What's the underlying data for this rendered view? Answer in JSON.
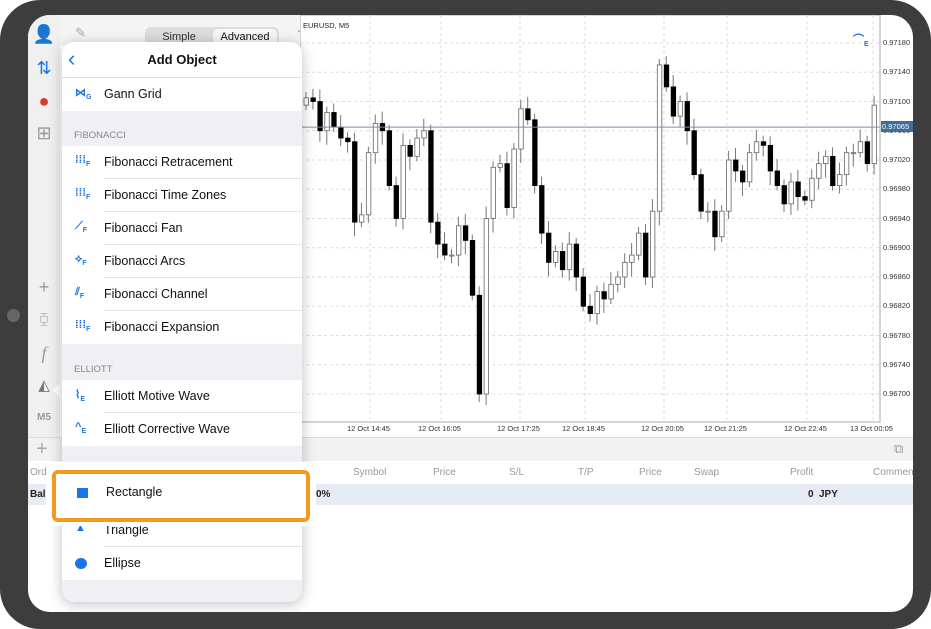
{
  "sidebar": {
    "items": [
      "account-icon",
      "trade-transfer-icon",
      "chat-icon",
      "new-order-icon",
      "crosshair-icon",
      "chart-type-icon",
      "indicators-icon",
      "objects-icon",
      "timeframe",
      "add-icon"
    ],
    "timeframe": "M5"
  },
  "toolbar": {
    "simple_label": "Simple",
    "advanced_label": "Advanced",
    "pencil": "pencil-icon",
    "add": "plus-icon"
  },
  "chart": {
    "symbol_label": "EURUSD, M5",
    "bid_label": "0.97065",
    "price_ticks": [
      "0.97180",
      "0.97140",
      "0.97100",
      "0.97060",
      "0.97020",
      "0.96980",
      "0.96940",
      "0.96900",
      "0.96860",
      "0.96820",
      "0.96780",
      "0.96740",
      "0.96700"
    ],
    "time_ticks": [
      "12 Oct 14:45",
      "12 Oct 16:05",
      "12 Oct 17:25",
      "12 Oct 18:45",
      "12 Oct 20:05",
      "12 Oct 21:25",
      "12 Oct 22:45",
      "13 Oct 00:05"
    ]
  },
  "chart_data": {
    "type": "candlestick",
    "symbol": "EURUSD",
    "timeframe": "M5",
    "ylim": [
      0.9668,
      0.9721
    ],
    "bid": 0.97065,
    "first_open": 0.97095,
    "closes": [
      0.97105,
      0.971,
      0.9706,
      0.97085,
      0.97065,
      0.9705,
      0.97045,
      0.96935,
      0.96945,
      0.9703,
      0.9707,
      0.9706,
      0.96985,
      0.9694,
      0.9704,
      0.97025,
      0.9705,
      0.9706,
      0.96935,
      0.96905,
      0.9689,
      0.9689,
      0.9693,
      0.9691,
      0.96835,
      0.967,
      0.9694,
      0.9701,
      0.97015,
      0.96955,
      0.97035,
      0.9709,
      0.97075,
      0.96985,
      0.9692,
      0.9688,
      0.96895,
      0.9687,
      0.96905,
      0.9686,
      0.9682,
      0.9681,
      0.9684,
      0.9683,
      0.9685,
      0.9686,
      0.9688,
      0.9689,
      0.9692,
      0.9686,
      0.9695,
      0.9715,
      0.9712,
      0.9708,
      0.971,
      0.9706,
      0.97,
      0.9695,
      0.9695,
      0.96915,
      0.9695,
      0.9702,
      0.97005,
      0.9699,
      0.9703,
      0.97045,
      0.9704,
      0.97005,
      0.96985,
      0.9696,
      0.9699,
      0.9697,
      0.96965,
      0.96995,
      0.97015,
      0.97025,
      0.96985,
      0.97,
      0.9703,
      0.9703,
      0.97045,
      0.97015,
      0.97095
    ]
  },
  "trade_table": {
    "headers": [
      "Ord",
      "Symbol",
      "Price",
      "S/L",
      "T/P",
      "Price",
      "Swap",
      "Profit",
      "Comment"
    ],
    "balance_row": {
      "label": "Bal",
      "percent": "0%",
      "profit": "0",
      "currency": "JPY"
    }
  },
  "popup": {
    "title": "Add Object",
    "back": "chevron-left-icon",
    "gann": [
      {
        "label": "Gann Grid",
        "icon": "gann-grid-icon"
      }
    ],
    "fibonacci_header": "FIBONACCI",
    "fibonacci": [
      {
        "label": "Fibonacci Retracement"
      },
      {
        "label": "Fibonacci Time Zones"
      },
      {
        "label": "Fibonacci Fan"
      },
      {
        "label": "Fibonacci Arcs"
      },
      {
        "label": "Fibonacci Channel"
      },
      {
        "label": "Fibonacci Expansion"
      }
    ],
    "elliott_header": "ELLIOTT",
    "elliott": [
      {
        "label": "Elliott Motive Wave"
      },
      {
        "label": "Elliott Corrective Wave"
      }
    ],
    "shapes": [
      {
        "label": "Rectangle"
      },
      {
        "label": "Triangle"
      },
      {
        "label": "Ellipse"
      }
    ]
  },
  "highlight": {
    "label": "Rectangle",
    "color": "#f39a1f"
  },
  "colors": {
    "accent": "#1b74e8",
    "highlight": "#f39a1f",
    "bid_line": "#7a90a8"
  }
}
